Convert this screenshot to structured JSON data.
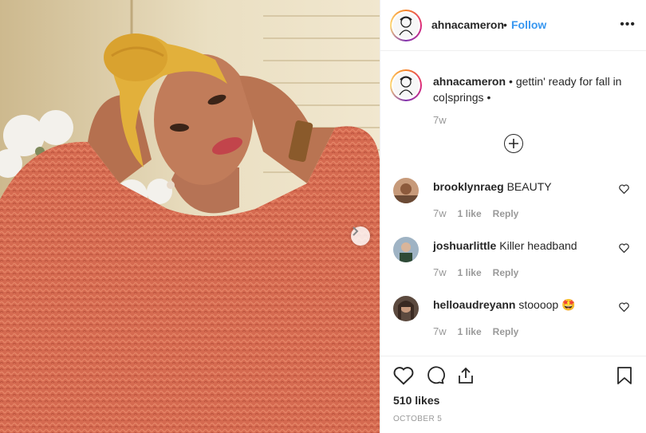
{
  "post": {
    "username": "ahnacameron",
    "separator": "•",
    "follow_label": "Follow",
    "more_label": "•••",
    "caption_text": "• gettin' ready for fall in co|springs •",
    "caption_time": "7w",
    "likes_count": "510 likes",
    "date": "OCTOBER 5"
  },
  "comments": [
    {
      "username": "brooklynraeg",
      "text": "BEAUTY",
      "time": "7w",
      "likes": "1 like",
      "reply": "Reply",
      "emoji": ""
    },
    {
      "username": "joshuarlittle",
      "text": "Killer headband",
      "time": "7w",
      "likes": "1 like",
      "reply": "Reply",
      "emoji": ""
    },
    {
      "username": "helloaudreyann",
      "text": "stoooop",
      "time": "7w",
      "likes": "1 like",
      "reply": "Reply",
      "emoji": "🤩"
    }
  ],
  "icons": {
    "more": "more-options-icon",
    "load_more": "plus-circle-icon",
    "next": "chevron-right-icon",
    "like": "heart-icon",
    "comment": "comment-icon",
    "share": "share-icon",
    "save": "bookmark-icon"
  },
  "colors": {
    "follow": "#3897f0",
    "muted": "#999999",
    "text": "#262626",
    "sweater": "#d66a4f",
    "headwrap": "#e2b03b"
  }
}
